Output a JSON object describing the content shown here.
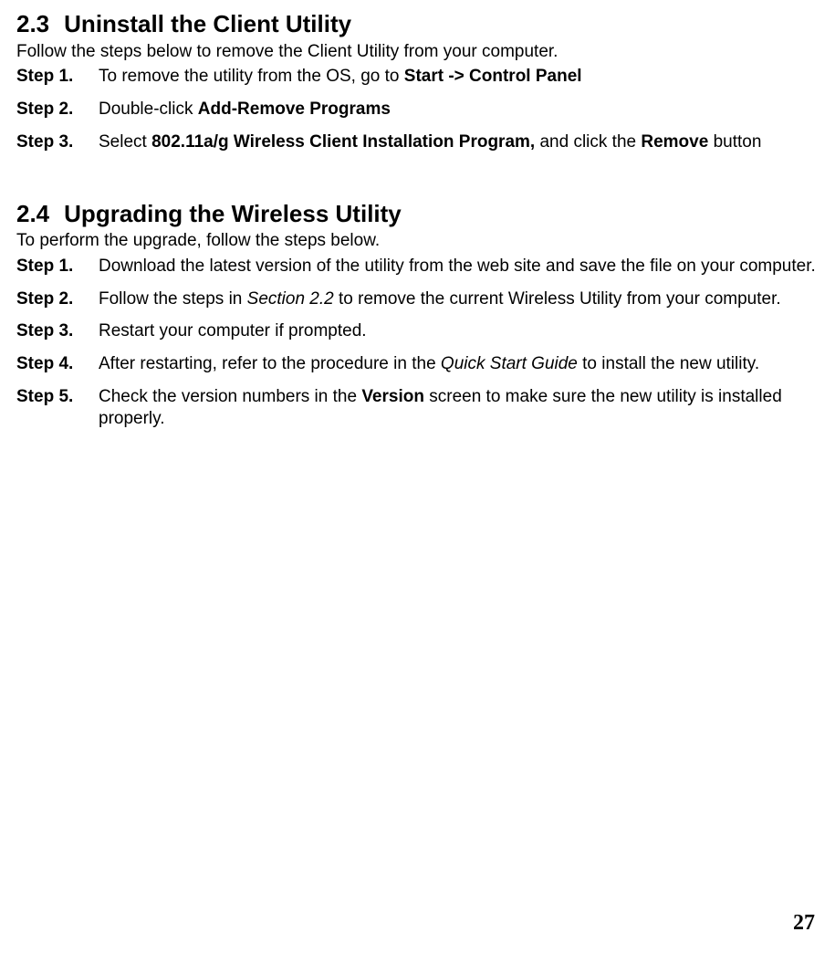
{
  "section23": {
    "number": "2.3",
    "title": "Uninstall the Client Utility",
    "intro": "Follow the steps below to remove the Client Utility from your computer.",
    "steps": [
      {
        "label": "Step 1.",
        "pre": "To remove the utility from the OS, go to ",
        "bold": "Start -> Control Panel"
      },
      {
        "label": "Step 2.",
        "pre": "Double-click ",
        "bold": "Add-Remove Programs"
      },
      {
        "label": "Step 3.",
        "pre": "Select ",
        "bold1": "802.11a/g Wireless Client Installation Program,",
        "mid": " and click the ",
        "bold2": "Remove",
        "post": " button"
      }
    ]
  },
  "section24": {
    "number": "2.4",
    "title": "Upgrading the Wireless Utility",
    "intro": "To perform the upgrade, follow the steps below.",
    "steps": [
      {
        "label": "Step 1.",
        "text": "Download the latest version of the utility from the web site and save the file on your computer."
      },
      {
        "label": "Step 2.",
        "pre": "Follow the steps in ",
        "italic": "Section 2.2",
        "post": " to remove the current Wireless Utility from your computer."
      },
      {
        "label": "Step 3.",
        "text": "Restart your computer if prompted."
      },
      {
        "label": "Step 4.",
        "pre": "After restarting, refer to the procedure in the ",
        "italic": "Quick Start Guide",
        "post": " to install the new utility."
      },
      {
        "label": "Step 5.",
        "pre": "Check the version numbers in the ",
        "bold": "Version",
        "post": " screen to make sure the new utility is installed properly."
      }
    ]
  },
  "page_number": "27"
}
